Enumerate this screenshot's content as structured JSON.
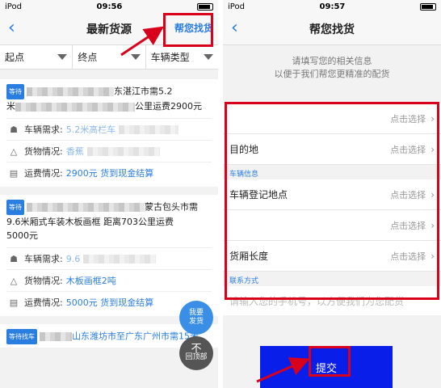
{
  "left_screen": {
    "status": {
      "carrier": "iPod",
      "time": "09:56"
    },
    "nav": {
      "title": "最新货源",
      "help": "帮您找货"
    },
    "filters": [
      {
        "label": "起点"
      },
      {
        "label": "终点"
      },
      {
        "label": "车辆类型"
      }
    ],
    "cards": [
      {
        "tag": "等待",
        "title_line1": "东湛江市需5.2",
        "title_line2_prefix": "米",
        "title_line2": "公里运费2900元",
        "rows": [
          {
            "icon": "truck-icon",
            "label": "车辆需求:",
            "value": "5.2米高栏车"
          },
          {
            "icon": "cargo-icon",
            "label": "货物情况:",
            "value": "香蕉"
          },
          {
            "icon": "money-icon",
            "label": "运费情况:",
            "value": "2900元 货到现金结算"
          }
        ]
      },
      {
        "tag": "等待",
        "title_line1": "蒙古包头市需",
        "title_line2": "9.6米厢式车装木板画框 距离703公里运费",
        "title_line3": "5000元",
        "rows": [
          {
            "icon": "truck-icon",
            "label": "车辆需求:",
            "value": "9.6"
          },
          {
            "icon": "cargo-icon",
            "label": "货物情况:",
            "value": "木板画框2吨"
          },
          {
            "icon": "money-icon",
            "label": "运费情况:",
            "value": "5000元 货到现金结算"
          }
        ]
      },
      {
        "tag": "等待找车",
        "title_line1": "山东潍坊市至广东广州市需15米"
      }
    ],
    "float_post": {
      "line1": "我要",
      "line2": "发货"
    },
    "float_top": {
      "glyph": "不",
      "label": "回顶部"
    }
  },
  "right_screen": {
    "status": {
      "carrier": "iPod",
      "time": "09:57"
    },
    "nav": {
      "title": "帮您找货"
    },
    "hint": {
      "line1": "请填写您的相关信息",
      "line2": "以便于我们帮您更精准的配货"
    },
    "sections": {
      "route_label": "",
      "vehicle_label": "车辆信息",
      "contact_label": "联系方式"
    },
    "route_fields": [
      {
        "label": "",
        "pick": "点击选择"
      },
      {
        "label": "目的地",
        "pick": "点击选择"
      }
    ],
    "vehicle_fields": [
      {
        "label": "车辆登记地点",
        "pick": "点击选择"
      },
      {
        "label": "",
        "pick": "点击选择"
      },
      {
        "label": "货厢长度",
        "pick": "点击选择"
      }
    ],
    "phone_placeholder": "请输入您的手机号，以方便我们为您配货",
    "submit": "提交"
  }
}
